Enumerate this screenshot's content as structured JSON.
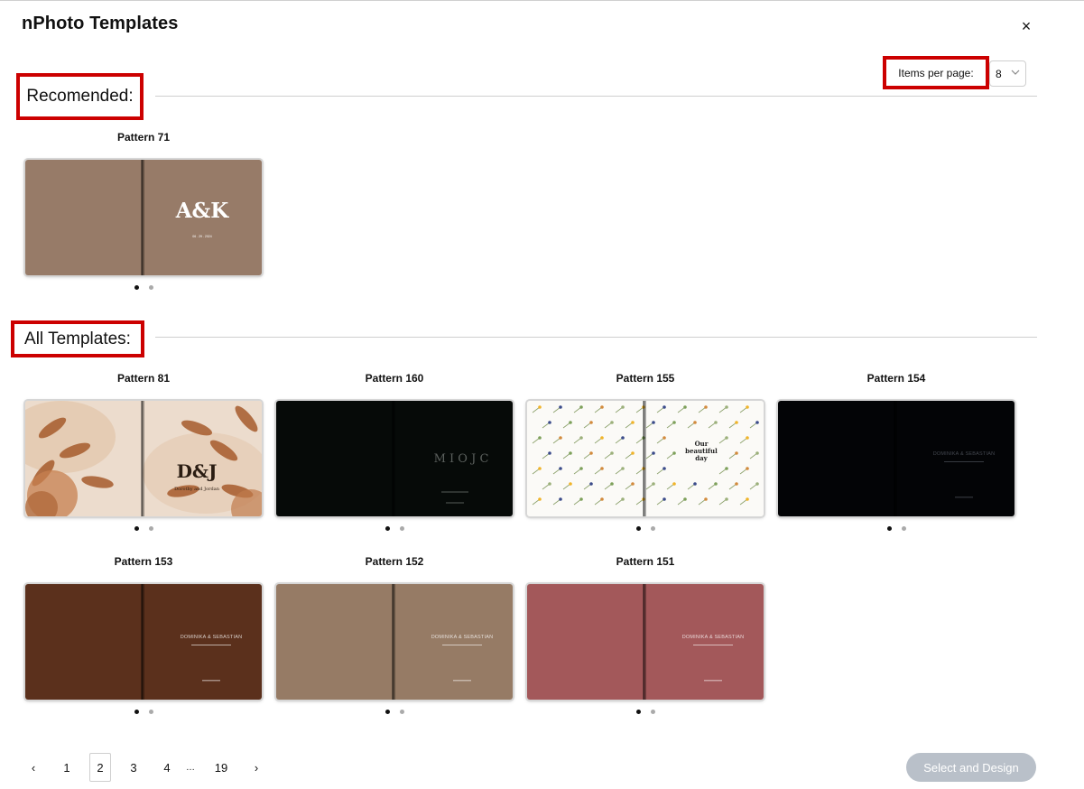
{
  "header": {
    "title": "nPhoto Templates",
    "close": "×"
  },
  "items_per_page": {
    "label": "Items per page:",
    "value": "8"
  },
  "sections": {
    "recommended": "Recomended:",
    "all": "All Templates:"
  },
  "recommended": [
    {
      "title": "Pattern 71",
      "style": "ak",
      "bg": "#977b68",
      "text_main": "A&K",
      "text_sub": "06 . 29 . 2024"
    }
  ],
  "templates": [
    {
      "title": "Pattern 81",
      "style": "floral",
      "bg": "#ead9ca",
      "text_main": "D&J",
      "text_sub": "Dorothy and Jordan"
    },
    {
      "title": "Pattern 160",
      "style": "dark-letters",
      "bg": "#060a08",
      "text_main": "M  I  O  J  C"
    },
    {
      "title": "Pattern 155",
      "style": "sprigs",
      "bg": "#fbfaf7",
      "text_main": "Our beautiful day"
    },
    {
      "title": "Pattern 154",
      "style": "plain-name",
      "bg": "#030406",
      "text_main": "DOMINIKA & SEBASTIAN"
    },
    {
      "title": "Pattern 153",
      "style": "plain-name",
      "bg": "#5b301c",
      "text_main": "DOMINIKA & SEBASTIAN"
    },
    {
      "title": "Pattern 152",
      "style": "plain-name",
      "bg": "#967b65",
      "text_main": "DOMINIKA & SEBASTIAN"
    },
    {
      "title": "Pattern 151",
      "style": "plain-name",
      "bg": "#a3585a",
      "text_main": "DOMINIKA & SEBASTIAN"
    }
  ],
  "pagination": {
    "prev": "‹",
    "pages": [
      "1",
      "2",
      "3",
      "4",
      "…",
      "19"
    ],
    "current": "2",
    "next": "›"
  },
  "cta": "Select and Design",
  "colors": {
    "highlight": "#cc0000",
    "cta_disabled": "#b9c0c9",
    "rule": "#cfcfcf"
  }
}
